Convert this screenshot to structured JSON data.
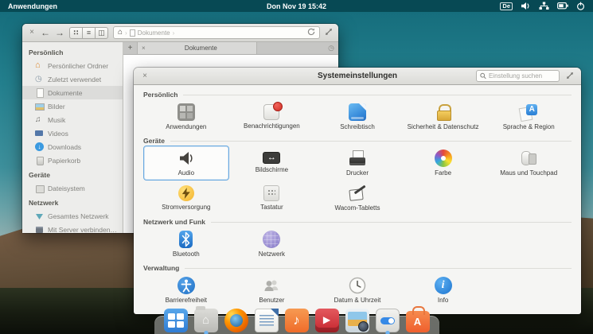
{
  "panel": {
    "app_menu": "Anwendungen",
    "clock": "Don Nov 19 15:42",
    "keyboard_layout": "De"
  },
  "files": {
    "path_location": "Dokumente",
    "tab_label": "Dokumente",
    "sidebar": {
      "sections": [
        {
          "label": "Persönlich",
          "items": [
            "Persönlicher Ordner",
            "Zuletzt verwendet",
            "Dokumente",
            "Bilder",
            "Musik",
            "Videos",
            "Downloads",
            "Papierkorb"
          ]
        },
        {
          "label": "Geräte",
          "items": [
            "Dateisystem"
          ]
        },
        {
          "label": "Netzwerk",
          "items": [
            "Gesamtes Netzwerk",
            "Mit Server verbinden…"
          ]
        }
      ]
    }
  },
  "settings": {
    "title": "Systemeinstellungen",
    "search_placeholder": "Einstellung suchen",
    "selected_item": "Audio",
    "sections": [
      {
        "label": "Persönlich",
        "items": [
          "Anwendungen",
          "Benachrichtigungen",
          "Schreibtisch",
          "Sicherheit & Datenschutz",
          "Sprache & Region"
        ]
      },
      {
        "label": "Geräte",
        "items": [
          "Audio",
          "Bildschirme",
          "Drucker",
          "Farbe",
          "Maus und Touchpad",
          "Stromversorgung",
          "Tastatur",
          "Wacom-Tabletts"
        ]
      },
      {
        "label": "Netzwerk und Funk",
        "items": [
          "Bluetooth",
          "Netzwerk"
        ]
      },
      {
        "label": "Verwaltung",
        "items": [
          "Barrierefreiheit",
          "Benutzer",
          "Datum & Uhrzeit",
          "Info"
        ]
      }
    ]
  },
  "dock": {
    "items": [
      "multitasking-view",
      "files",
      "web-browser",
      "writer",
      "music",
      "videos",
      "photos",
      "system-settings",
      "appcenter"
    ]
  },
  "colors": {
    "accent": "#3689e6",
    "panel_background": "#074650",
    "selection_border": "#68a8e0",
    "dock_indicator": "#6cb2f0"
  }
}
